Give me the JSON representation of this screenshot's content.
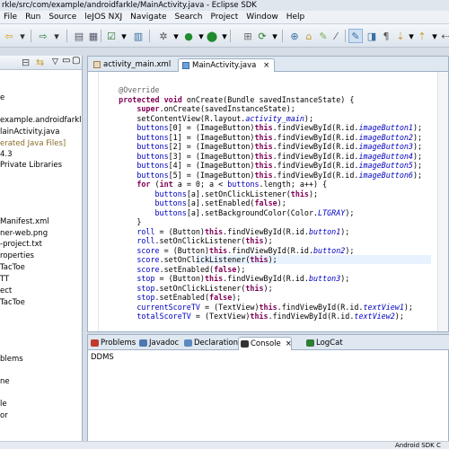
{
  "window": {
    "title": "rkle/src/com/example/androidfarkle/MainActivity.java - Eclipse SDK"
  },
  "menu": [
    "File",
    "Run",
    "Source",
    "leJOS NXJ",
    "Navigate",
    "Search",
    "Project",
    "Window",
    "Help"
  ],
  "package_explorer": {
    "items": [
      "e",
      "example.androidfarkle",
      "lainActivity.java",
      "erated Java Files]",
      "4.3",
      "Private Libraries",
      "Manifest.xml",
      "ner-web.png",
      "-project.txt",
      "roperties",
      "TacToe",
      "TT",
      "ect",
      "TacToe",
      "blems",
      "ne",
      "le",
      "or"
    ]
  },
  "editor": {
    "tabs": [
      {
        "label": "activity_main.xml",
        "icon": "xml-file-icon"
      },
      {
        "label": "MainActivity.java",
        "icon": "java-file-icon",
        "active": true
      }
    ],
    "code_lines": [
      "    @Override",
      "    protected void onCreate(Bundle savedInstanceState) {",
      "        super.onCreate(savedInstanceState);",
      "        setContentView(R.layout.activity_main);",
      "        buttons[0] = (ImageButton)this.findViewById(R.id.imageButton1);",
      "        buttons[1] = (ImageButton)this.findViewById(R.id.imageButton2);",
      "        buttons[2] = (ImageButton)this.findViewById(R.id.imageButton3);",
      "        buttons[3] = (ImageButton)this.findViewById(R.id.imageButton4);",
      "        buttons[4] = (ImageButton)this.findViewById(R.id.imageButton5);",
      "        buttons[5] = (ImageButton)this.findViewById(R.id.imageButton6);",
      "        for (int a = 0; a < buttons.length; a++) {",
      "            buttons[a].setOnClickListener(this);",
      "            buttons[a].setEnabled(false);",
      "            buttons[a].setBackgroundColor(Color.LTGRAY);",
      "        }",
      "        roll = (Button)this.findViewById(R.id.button1);",
      "        roll.setOnClickListener(this);",
      "        score = (Button)this.findViewById(R.id.button2);",
      "        score.setOnClickListener(this);",
      "        score.setEnabled(false);",
      "        stop = (Button)this.findViewById(R.id.button3);",
      "        stop.setOnClickListener(this);",
      "        stop.setEnabled(false);",
      "        currentScoreTV = (TextView)this.findViewById(R.id.textView1);",
      "        totalScoreTV = (TextView)this.findViewById(R.id.textView2);"
    ]
  },
  "bottom": {
    "tabs": [
      {
        "label": "Problems",
        "color": "#c0392b"
      },
      {
        "label": "Javadoc",
        "color": "#4a78b0"
      },
      {
        "label": "Declaration",
        "color": "#5b8ac0"
      },
      {
        "label": "Console",
        "color": "#333333",
        "active": true
      },
      {
        "label": "LogCat",
        "color": "#2f7d32"
      }
    ],
    "console_text": "DDMS"
  },
  "statusbar": {
    "right": "Android SDK C"
  },
  "colors": {
    "keyword": "#7f0055",
    "field": "#0000c0",
    "annotation": "#646464"
  }
}
